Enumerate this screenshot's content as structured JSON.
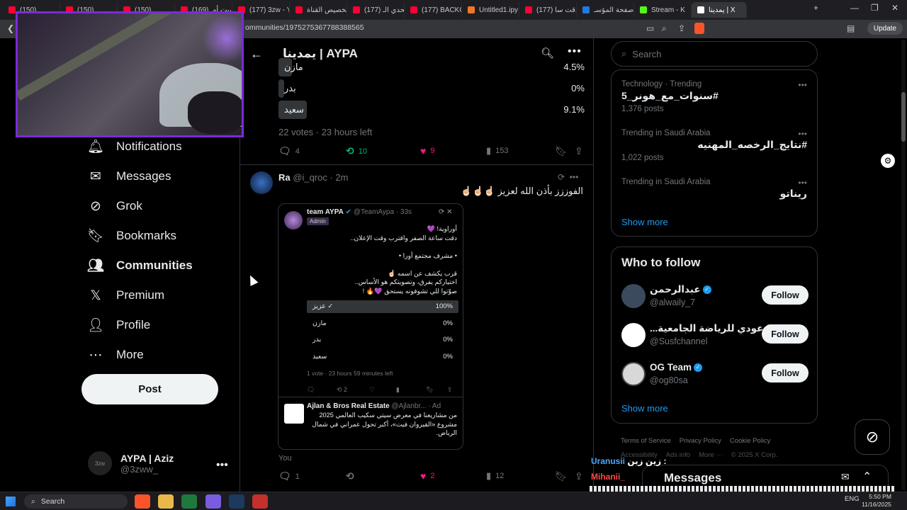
{
  "browser": {
    "tabs": [
      {
        "label": "(150)",
        "color": "#ff0033"
      },
      {
        "label": "(150)",
        "color": "#ff0033"
      },
      {
        "label": "(150)",
        "color": "#ff0033"
      },
      {
        "label": "جريبت أمـ (169)",
        "color": "#ff0033"
      },
      {
        "label": "(177) 3zw - Y",
        "color": "#ff0033"
      },
      {
        "label": "تخصيص القناة",
        "color": "#ff0033"
      },
      {
        "label": "(177) تحدي الـ",
        "color": "#ff0033"
      },
      {
        "label": "(177) BACKGR",
        "color": "#ff0033"
      },
      {
        "label": "Untitled1.ipy",
        "color": "#f37626"
      },
      {
        "label": "(177) دقت سا",
        "color": "#ff0033"
      },
      {
        "label": "صفحة المؤسـ",
        "color": "#1f7ae0"
      },
      {
        "label": "Stream - K",
        "color": "#53fc18"
      },
      {
        "label": "يمدينا | X",
        "color": "#ffffff"
      }
    ],
    "url": "ommunities/1975275367788388565",
    "update_label": "Update"
  },
  "nav": {
    "items": [
      {
        "label": "Notifications",
        "icon": "bell-icon"
      },
      {
        "label": "Messages",
        "icon": "envelope-icon"
      },
      {
        "label": "Grok",
        "icon": "grok-icon"
      },
      {
        "label": "Bookmarks",
        "icon": "bookmark-icon"
      },
      {
        "label": "Communities",
        "icon": "communities-icon"
      },
      {
        "label": "Premium",
        "icon": "x-logo-icon"
      },
      {
        "label": "Profile",
        "icon": "person-icon"
      },
      {
        "label": "More",
        "icon": "more-circle-icon"
      }
    ],
    "post_label": "Post",
    "account": {
      "name": "AYPA | Aziz",
      "handle": "@3zww_",
      "avatar_text": "3zw"
    }
  },
  "center": {
    "title": "يمدينا | AYPA",
    "poll": {
      "options": [
        {
          "label": "مازن",
          "pct": "4.5%",
          "value": 4.5
        },
        {
          "label": "بدر",
          "pct": "0%",
          "value": 0
        },
        {
          "label": "سعيد",
          "pct": "9.1%",
          "value": 9.1
        }
      ],
      "meta": "22 votes · 23 hours left",
      "actions": {
        "replies": "4",
        "reposts": "10",
        "likes": "9",
        "views": "153"
      }
    },
    "reply": {
      "name": "Ra",
      "handle": "@i_qroc · 2m",
      "text": "الفوززز بأذن الله لعزيز ☝🏻☝🏻☝🏻",
      "quote": {
        "name": "team AYPA",
        "handle": "@TeamAypa · 33s",
        "badge": "Admin",
        "lines": [
          "أوراوية! 💜",
          "دقت ساعة الصفر واقترب وقت الإعلان..",
          "",
          "• مشرف مجتمع أورا •",
          "",
          "قرب يكشف عن اسمه ☝🏻",
          "اختياركم يفرق، وتصويتكم هو الأساس..",
          "صوّتوا للي تشوفونه يستحق 💜🔥 !"
        ],
        "poll": [
          {
            "label": "عزيز ✓",
            "pct": "100%",
            "value": 100
          },
          {
            "label": "مازن",
            "pct": "0%",
            "value": 0
          },
          {
            "label": "بدر",
            "pct": "0%",
            "value": 0
          },
          {
            "label": "سعيد",
            "pct": "0%",
            "value": 0
          }
        ],
        "meta": "1 vote · 23 hours 59 minutes left",
        "reposts": "2",
        "ad": {
          "name": "Ajlan & Bros Real Estate",
          "handle": "@Ajlanbr... · Ad",
          "lines": [
            "من مشاريعنا في معرض سيتي سكيب العالمي 2025",
            "مشروع «القيروان فيت»، أكبر تحول عمراني في شمال",
            "الرياض."
          ]
        }
      },
      "you_label": "You",
      "actions": {
        "replies": "1",
        "likes": "2",
        "views": "12"
      }
    }
  },
  "right": {
    "search_placeholder": "Search",
    "trends": [
      {
        "category": "Technology · Trending",
        "title": "سنوات_مع_هونر_5#",
        "count": "1,376 posts"
      },
      {
        "category": "Trending in Saudi Arabia",
        "title": "#نتايج_الرخصه_المهنيه",
        "count": "1,022 posts"
      },
      {
        "category": "Trending in Saudi Arabia",
        "title": "ريناتو",
        "count": ""
      }
    ],
    "show_more": "Show more",
    "who_to_follow": {
      "title": "Who to follow",
      "accounts": [
        {
          "name": "عبدالرحمن",
          "handle": "@alwaily_7",
          "badge": "blue"
        },
        {
          "name": "...عودي للرياضة الجامعية",
          "handle": "@Susfchannel",
          "badge": "gold"
        },
        {
          "name": "OG Team",
          "handle": "@og80sa",
          "badge": "blue"
        }
      ],
      "follow_label": "Follow",
      "show_more": "Show more"
    },
    "footer": [
      "Terms of Service",
      "Privacy Policy",
      "Cookie Policy"
    ],
    "footer2": [
      "Accessibility",
      "Ads info",
      "More ···",
      "© 2025 X Corp."
    ],
    "messages_label": "Messages"
  },
  "chat_overlay": {
    "user1": "Uranusii",
    "msg1": "زين زين :",
    "user2": "Mihanii_"
  },
  "taskbar": {
    "search_label": "Search",
    "lang": "ENG",
    "time": "5:50 PM",
    "date": "11/16/2025"
  }
}
